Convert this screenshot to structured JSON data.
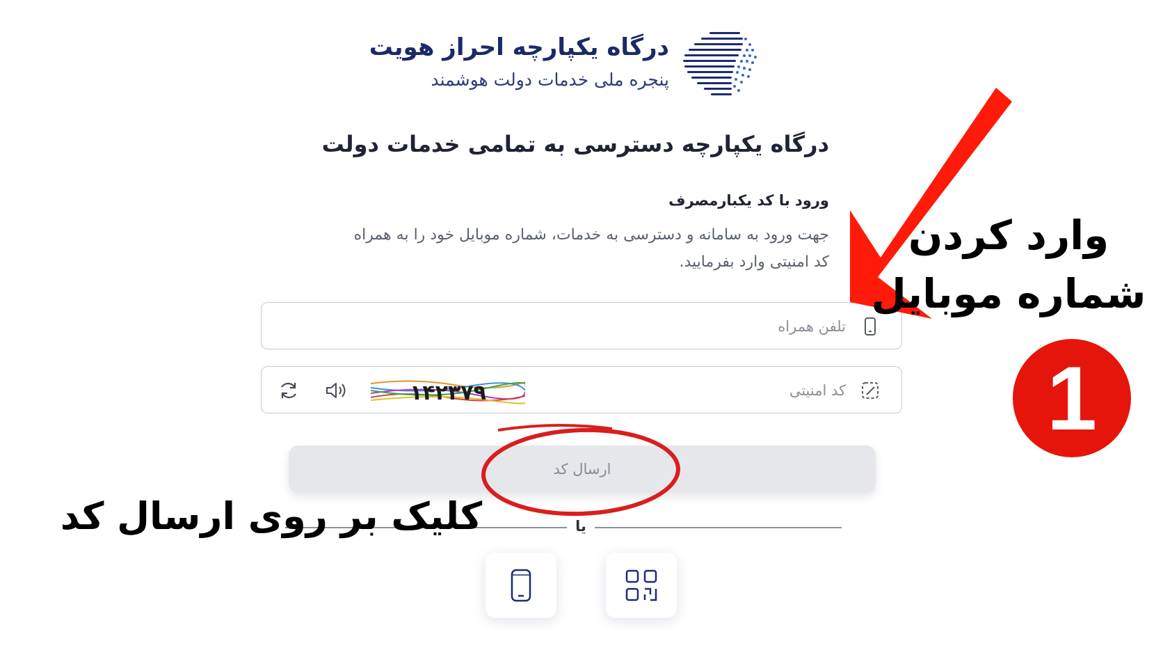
{
  "header": {
    "logo_icon": "globe-icon",
    "title": "درگاه یکپارچه احراز هویت",
    "subtitle": "پنجره ملی خدمات دولت هوشمند"
  },
  "main": {
    "page_title": "درگاه یکپارچه دسترسی به تمامی خدمات دولت",
    "section_title": "ورود با کد یکبارمصرف",
    "description": "جهت ورود به سامانه و دسترسی به خدمات، شماره موبایل خود را به همراه کد امنیتی وارد بفرمایید."
  },
  "form": {
    "phone": {
      "placeholder": "تلفن همراه",
      "value": "",
      "icon": "mobile-phone-icon"
    },
    "captcha": {
      "placeholder": "کد امنیتی",
      "value": "",
      "icon": "security-code-icon",
      "image_text": "۱۴۲۳۷۹",
      "audio_icon": "speaker-icon",
      "refresh_icon": "refresh-icon"
    },
    "send_button_label": "ارسال کد",
    "divider_text": "یا",
    "alt_logins": [
      {
        "icon": "mobile-phone-icon"
      },
      {
        "icon": "qr-code-icon"
      }
    ]
  },
  "annotations": {
    "top_line1": "وارد کردن",
    "top_line2": "شماره موبایل",
    "step_number": "1",
    "bottom_text": "کلیک بر روی ارسال کد",
    "accent_color": "#e5150c"
  }
}
